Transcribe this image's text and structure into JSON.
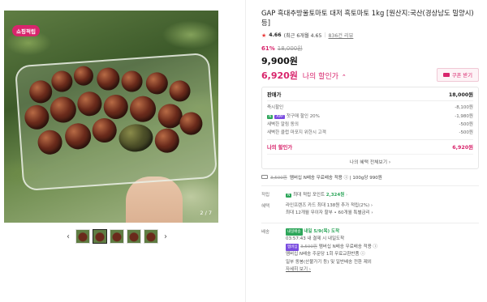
{
  "gallery": {
    "badge": "쇼핑적립",
    "page_indicator": "2 / 7",
    "prev_arrow": "‹",
    "next_arrow": "›",
    "thumb_count": 5
  },
  "product": {
    "title": "GAP 흑대추방울토마토 대저 흑토마토 1kg [원산지:국산(경상남도 밀양시) 등]",
    "rating_score": "4.66",
    "rating_text": "(최근 6개월 4.65",
    "review_text": "836건 리뷰",
    "discount_rate": "61%",
    "original_price": "18,000원",
    "price": "9,900원",
    "my_price": "6,920원",
    "my_price_label": "나의 할인가",
    "coupon_button": "쿠폰 받기"
  },
  "breakdown": {
    "head_label": "판매가",
    "head_value": "18,000원",
    "rows": [
      {
        "tag": "",
        "label": "즉시할인",
        "value": "-8,100원"
      },
      {
        "tag": "N",
        "tag2": "APP",
        "label": "첫구매 할인 20%",
        "value": "-1,980원"
      },
      {
        "tag": "",
        "label": "새벽한 알림 동의",
        "value": "-500원"
      },
      {
        "tag": "",
        "label": "새벽한 클럽 마포지 위한시 고객",
        "value": "-500원"
      }
    ],
    "total_label": "나의 할인가",
    "total_value": "6,920원",
    "more_label": "나의 혜택 전체보기 ›"
  },
  "shipping_line": {
    "strike": "3,500원",
    "text": "멤버십 N배송 무료배송 적용 ⓘ | 100g당 990원"
  },
  "points": {
    "label": "적립",
    "pill": "N",
    "text_prefix": "최대 적립 포인트",
    "amount": "2,324원",
    "arrow": "›"
  },
  "benefits": {
    "label": "혜택",
    "line1": "라인프렌즈 카드 최대 138원 추가 적립(2%) ›",
    "line2": "최대 12개월 무이자 할부 • 60개월 특별금리 ›"
  },
  "delivery": {
    "label": "배송",
    "pill": "내일배송",
    "arrive": "내일 5/9(목) 도착",
    "cutoff": "03:57:43 내 결제 시 내일도착",
    "pill2": "멤버십",
    "line3_strike": "3,500원",
    "line3": "멤버십 N배송 무료배송 적용 ⓘ",
    "line4": "멤버십 N배송 주문당 1회 무료교환반품 ⓘ",
    "line5": "일부 동봉(산불가기 등) 및 일반배송 전환 제외",
    "more": "자세히 보기 ›"
  },
  "colors": {
    "brand": "#d8256c",
    "green": "#2da65a",
    "purple": "#7a4ce0"
  }
}
